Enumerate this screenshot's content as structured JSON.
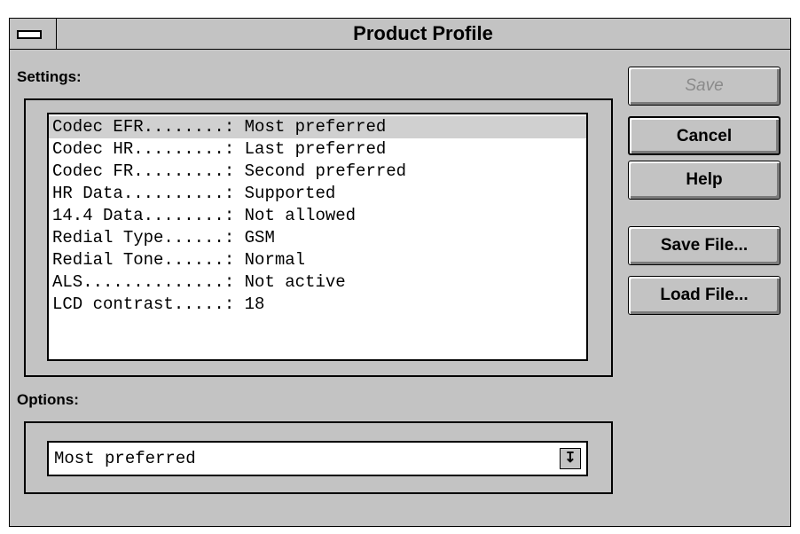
{
  "window": {
    "title": "Product Profile"
  },
  "settings": {
    "label": "Settings:",
    "items": [
      "Codec EFR........: Most preferred",
      "Codec HR.........: Last preferred",
      "Codec FR.........: Second preferred",
      "HR Data..........: Supported",
      "14.4 Data........: Not allowed",
      "Redial Type......: GSM",
      "Redial Tone......: Normal",
      "ALS..............: Not active",
      "LCD contrast.....: 18"
    ],
    "selected_index": 0
  },
  "options": {
    "label": "Options:",
    "selected_value": "Most preferred",
    "arrow_icon": "down-arrow-icon"
  },
  "buttons": {
    "save": "Save",
    "cancel": "Cancel",
    "help": "Help",
    "save_file": "Save File...",
    "load_file": "Load File..."
  }
}
